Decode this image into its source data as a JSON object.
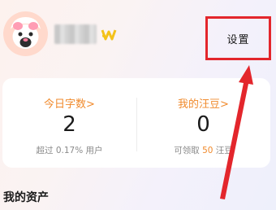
{
  "profile": {
    "avatar_icon": "avatar-icon",
    "vip_icon": "vip-badge-icon"
  },
  "header": {
    "settings_label": "设置"
  },
  "stats": {
    "today_words": {
      "title": "今日字数",
      "chevron": ">",
      "value": "2",
      "sub_prefix": "超过 ",
      "sub_highlight": "0.17%",
      "sub_suffix": " 用户"
    },
    "wangdou": {
      "title": "我的汪豆",
      "chevron": ">",
      "value": "0",
      "sub_prefix": "可领取 ",
      "sub_highlight": "50",
      "sub_suffix": " 汪豆"
    }
  },
  "assets": {
    "title": "我的资产"
  },
  "colors": {
    "accent_orange": "#f08a2c",
    "annotation_red": "#e3262c"
  }
}
